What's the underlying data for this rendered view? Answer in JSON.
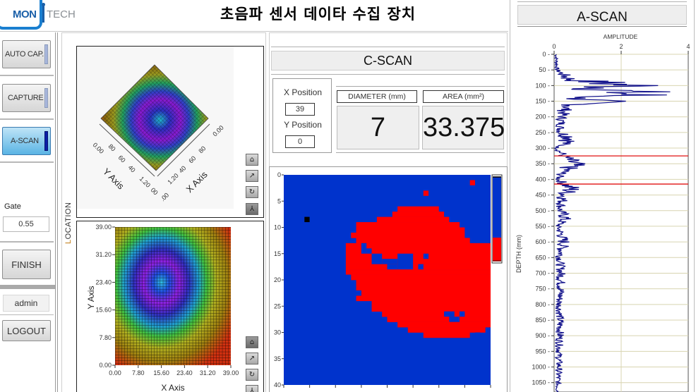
{
  "header": {
    "logo_mon": "MON",
    "logo_tech": "TECH",
    "title": "초음파 센서 데이타 수집 장치"
  },
  "sidebar": {
    "buttons": [
      {
        "label": "AUTO CAP.",
        "active": false
      },
      {
        "label": "CAPTURE",
        "active": false
      },
      {
        "label": "A-SCAN",
        "active": true
      }
    ],
    "gate_label": "Gate",
    "gate_value": "0.55",
    "finish_label": "FINISH",
    "user": "admin",
    "logout_label": "LOGOUT"
  },
  "location": {
    "label": "LOCATION",
    "surface3d": {
      "x_axis_label": "X Axis",
      "y_axis_label": "Y Axis"
    },
    "intensity": {
      "x_axis_label": "X Axis",
      "y_axis_label": "Y Axis",
      "x_ticks": [
        "0.00",
        "7.80",
        "15.60",
        "23.40",
        "31.20",
        "39.00"
      ],
      "y_ticks": [
        "39.00",
        "31.20",
        "23.40",
        "15.60",
        "7.80",
        "0.00"
      ]
    },
    "palette_icons": [
      "zoom-icon",
      "pan-xy-icon",
      "rotate-icon",
      "axes-reset-icon"
    ]
  },
  "cscan": {
    "title": "C-SCAN",
    "x_position_label": "X Position",
    "x_position_value": "39",
    "y_position_label": "Y Position",
    "y_position_value": "0",
    "diameter_label": "DIAMETER (mm)",
    "diameter_value": "7",
    "area_label": "AREA (mm²)",
    "area_value": "33.375",
    "y_ticks": [
      "0",
      "5",
      "10",
      "15",
      "20",
      "25",
      "30",
      "35",
      "40"
    ],
    "colors": {
      "background": "#0033cc",
      "defect": "#ff0000",
      "marker": "#000000"
    }
  },
  "ascan": {
    "title": "A-SCAN",
    "x_label": "AMPLITUDE",
    "y_label": "DEPTH (mm)",
    "x_ticks": [
      "0",
      "2",
      "4"
    ],
    "y_ticks": [
      "0",
      "50",
      "100",
      "150",
      "200",
      "250",
      "300",
      "350",
      "400",
      "450",
      "500",
      "550",
      "600",
      "650",
      "700",
      "750",
      "800",
      "850",
      "900",
      "950",
      "1000",
      "1050"
    ],
    "gate_lines_depth": [
      325,
      415
    ],
    "colors": {
      "signal": "#10108a",
      "gate": "#e01010",
      "grid": "#d8d4b0"
    }
  },
  "chart_data": [
    {
      "type": "line",
      "title": "A-SCAN",
      "xlabel": "AMPLITUDE",
      "ylabel": "DEPTH (mm)",
      "xlim": [
        0,
        4
      ],
      "ylim": [
        0,
        1080
      ],
      "grid": true,
      "series": [
        {
          "name": "amplitude",
          "depth": [
            0,
            50,
            80,
            100,
            110,
            120,
            130,
            140,
            150,
            170,
            200,
            250,
            270,
            300,
            330,
            350,
            380,
            400,
            430,
            450,
            500,
            520,
            550,
            600,
            650,
            700,
            750,
            800,
            850,
            900,
            950,
            1000,
            1050
          ],
          "values": [
            0.1,
            0.15,
            0.8,
            3.9,
            2.5,
            3.6,
            3.9,
            1.2,
            2.2,
            0.6,
            0.4,
            0.3,
            1.0,
            0.1,
            0.6,
            1.0,
            0.4,
            0.2,
            0.9,
            0.5,
            0.3,
            0.6,
            0.2,
            0.5,
            0.3,
            0.35,
            0.35,
            0.25,
            0.3,
            0.3,
            0.25,
            0.25,
            0.2
          ]
        }
      ],
      "annotations": [
        {
          "type": "hline",
          "depth": 325,
          "color": "red"
        },
        {
          "type": "hline",
          "depth": 415,
          "color": "red"
        }
      ]
    },
    {
      "type": "heatmap",
      "title": "C-SCAN",
      "xlim": [
        0,
        40
      ],
      "ylim": [
        0,
        40
      ],
      "y_ticks": [
        0,
        5,
        10,
        15,
        20,
        25,
        30,
        35,
        40
      ],
      "description": "binary defect map: red region roughly x 11-40, y 6-31 on blue background; black marker near (4, 8)"
    }
  ]
}
